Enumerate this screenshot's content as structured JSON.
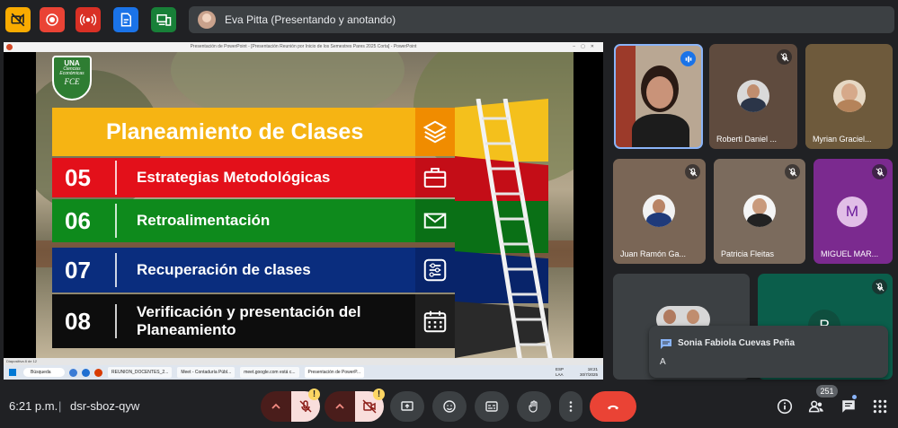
{
  "presenter": {
    "name": "Eva Pitta (Presentando y anotando)"
  },
  "toolbar": {
    "icons": [
      "camera-off-icon",
      "record-icon",
      "live-icon",
      "transcript-icon",
      "devices-icon"
    ],
    "colors": {
      "yellow": "#f9ab00",
      "red": "#ea4335",
      "darkred": "#d93025",
      "blue": "#1a73e8",
      "green": "#188038"
    }
  },
  "shared_screen": {
    "window_title": "Presentación de PowerPoint - [Presentación Reunión por Inicio de los Semestres Pares 2025 Corta] - PowerPoint",
    "slide": {
      "logo": {
        "t1": "UNA",
        "t2": "Ciencias Económicas",
        "t3": "FCE"
      },
      "title": "Planeamiento de Clases",
      "rows": [
        {
          "num": "05",
          "label": "Estrategias Metodológicas",
          "color": "#e3101a",
          "icon": "briefcase-icon"
        },
        {
          "num": "06",
          "label": "Retroalimentación",
          "color": "#0e8a1c",
          "icon": "mail-icon"
        },
        {
          "num": "07",
          "label": "Recuperación de clases",
          "color": "#0a2d7e",
          "icon": "sliders-icon"
        },
        {
          "num": "08",
          "label": "Verificación y presentación del Planeamiento",
          "color": "#0d0d0d",
          "icon": "calendar-icon"
        }
      ],
      "title_color": "#f6b413"
    },
    "status_text": "Diapositiva 8 de 12",
    "taskbar": {
      "search": "Búsqueda",
      "apps": [
        "REUNION_DOCENTES_2...",
        "Meet - Contaduría Públ...",
        "meet.google.com está c...",
        "Presentación de PowerP..."
      ],
      "lang1": "ESP",
      "lang2": "LAA",
      "time": "18:21",
      "date": "30/7/2025"
    }
  },
  "participants": [
    {
      "name": "",
      "kind": "presenter-video"
    },
    {
      "name": "Roberti Daniel ...",
      "kind": "photo"
    },
    {
      "name": "Myrian Graciel...",
      "kind": "photo"
    },
    {
      "name": "Juan Ramón Ga...",
      "kind": "photo"
    },
    {
      "name": "Patricia Fleitas",
      "kind": "photo"
    },
    {
      "name": "MIGUEL MAR...",
      "kind": "letter",
      "letter": "M"
    },
    {
      "name": "",
      "kind": "photo"
    },
    {
      "name": "",
      "kind": "letter",
      "letter": "P"
    }
  ],
  "toast": {
    "sender": "Sonia Fabiola Cuevas Peña",
    "message": "A"
  },
  "bottom": {
    "time": "6:21 p.m.",
    "separator": "|",
    "meeting_code": "dsr-sboz-qyw",
    "participant_count": "251",
    "warning": "!"
  }
}
